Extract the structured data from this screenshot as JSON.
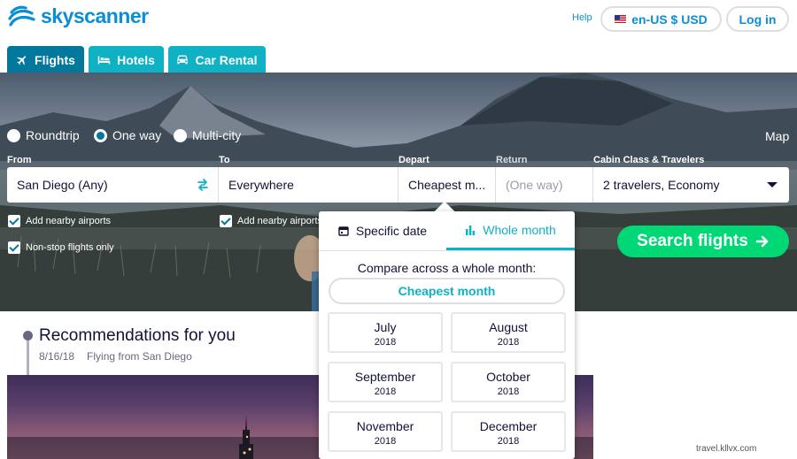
{
  "brand": {
    "name": "skyscanner",
    "color": "#0a8fd7"
  },
  "header": {
    "help": "Help",
    "locale": "en-US $ USD",
    "login": "Log in"
  },
  "tabs": [
    {
      "label": "Flights",
      "icon": "plane-icon",
      "active": true
    },
    {
      "label": "Hotels",
      "icon": "bed-icon",
      "active": false
    },
    {
      "label": "Car Rental",
      "icon": "car-icon",
      "active": false
    }
  ],
  "trip_types": [
    {
      "label": "Roundtrip",
      "selected": false
    },
    {
      "label": "One way",
      "selected": true
    },
    {
      "label": "Multi-city",
      "selected": false
    }
  ],
  "map_label": "Map",
  "search": {
    "labels": {
      "from": "From",
      "to": "To",
      "depart": "Depart",
      "return": "Return",
      "cabin": "Cabin Class & Travelers"
    },
    "from_value": "San Diego (Any)",
    "to_value": "Everywhere",
    "depart_value": "Cheapest m...",
    "return_value": "(One way)",
    "cabin_value": "2 travelers, Economy",
    "nearby_from": "Add nearby airports",
    "nearby_to": "Add nearby airports",
    "nonstop": "Non-stop flights only",
    "button": "Search flights",
    "button_color": "#00d775"
  },
  "date_picker": {
    "tabs": [
      {
        "label": "Specific date",
        "icon": "calendar-icon",
        "active": false
      },
      {
        "label": "Whole month",
        "icon": "bar-chart-icon",
        "active": true
      }
    ],
    "compare_text": "Compare across a whole month:",
    "cheapest_month": "Cheapest month",
    "months": [
      {
        "name": "July",
        "year": "2018"
      },
      {
        "name": "August",
        "year": "2018"
      },
      {
        "name": "September",
        "year": "2018"
      },
      {
        "name": "October",
        "year": "2018"
      },
      {
        "name": "November",
        "year": "2018"
      },
      {
        "name": "December",
        "year": "2018"
      }
    ]
  },
  "recommendations": {
    "title": "Recommendations for you",
    "date": "8/16/18",
    "subtitle": "Flying from San Diego"
  },
  "watermark": "travel.kllvx.com",
  "colors": {
    "tab": "#0fb1c5",
    "tab_active": "#02799c",
    "accent": "#0fb1c5"
  }
}
